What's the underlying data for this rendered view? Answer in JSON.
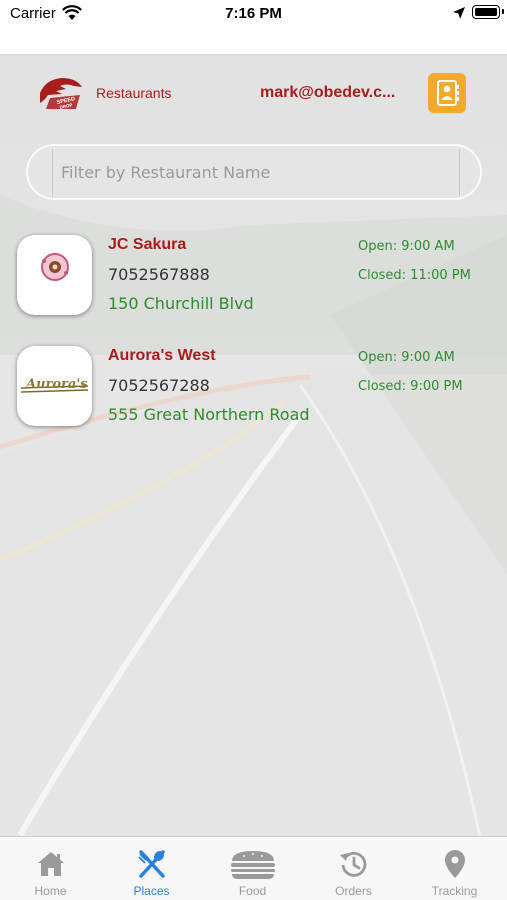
{
  "status_bar": {
    "carrier": "Carrier",
    "time": "7:16 PM"
  },
  "header": {
    "title": "Restaurants",
    "user_email": "mark@obedev.c..."
  },
  "search": {
    "placeholder": "Filter by Restaurant Name",
    "value": ""
  },
  "restaurants": [
    {
      "name": "JC Sakura",
      "phone": "7052567888",
      "address": "150 Churchill Blvd",
      "open": "Open: 9:00 AM",
      "closed": "Closed: 11:00 PM"
    },
    {
      "name": "Aurora's West",
      "phone": "7052567288",
      "address": "555 Great Northern Road",
      "open": "Open: 9:00 AM",
      "closed": "Closed: 9:00 PM"
    }
  ],
  "tabs": [
    {
      "label": "Home",
      "icon": "home-icon",
      "active": false
    },
    {
      "label": "Places",
      "icon": "fork-knife-icon",
      "active": true
    },
    {
      "label": "Food",
      "icon": "burger-icon",
      "active": false
    },
    {
      "label": "Orders",
      "icon": "history-icon",
      "active": false
    },
    {
      "label": "Tracking",
      "icon": "map-pin-icon",
      "active": false
    }
  ],
  "colors": {
    "brand_red": "#a81c1c",
    "accent_green": "#2f8a2f",
    "contact_orange": "#f2a92c",
    "tab_active": "#2a7fe0",
    "tab_inactive": "#9a9a9a"
  }
}
